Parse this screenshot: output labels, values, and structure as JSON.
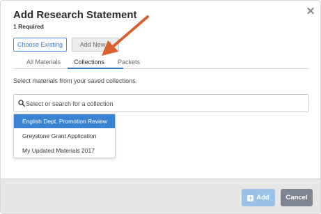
{
  "modal": {
    "title": "Add Research Statement",
    "subtitle": "1 Required",
    "close_icon": "close-icon"
  },
  "segments": {
    "existing_label": "Choose Existing",
    "new_label": "Add New F"
  },
  "tabs": [
    {
      "label": "All Materials"
    },
    {
      "label": "Collections"
    },
    {
      "label": "Packets"
    }
  ],
  "helper_text": "Select materials from your saved collections.",
  "search": {
    "placeholder": "Select or search for a collection",
    "icon": "search-icon"
  },
  "dropdown": {
    "items": [
      {
        "label": "English Dept. Promotion Review"
      },
      {
        "label": "Greystone Grant Application"
      },
      {
        "label": "My Updated Materials 2017"
      }
    ]
  },
  "footer": {
    "add_label": "Add",
    "cancel_label": "Cancel"
  },
  "colors": {
    "accent": "#3a82d2",
    "annotation_arrow": "#d9602f",
    "cancel_bg": "#7d8591",
    "add_disabled_bg": "#9bc2e6"
  }
}
